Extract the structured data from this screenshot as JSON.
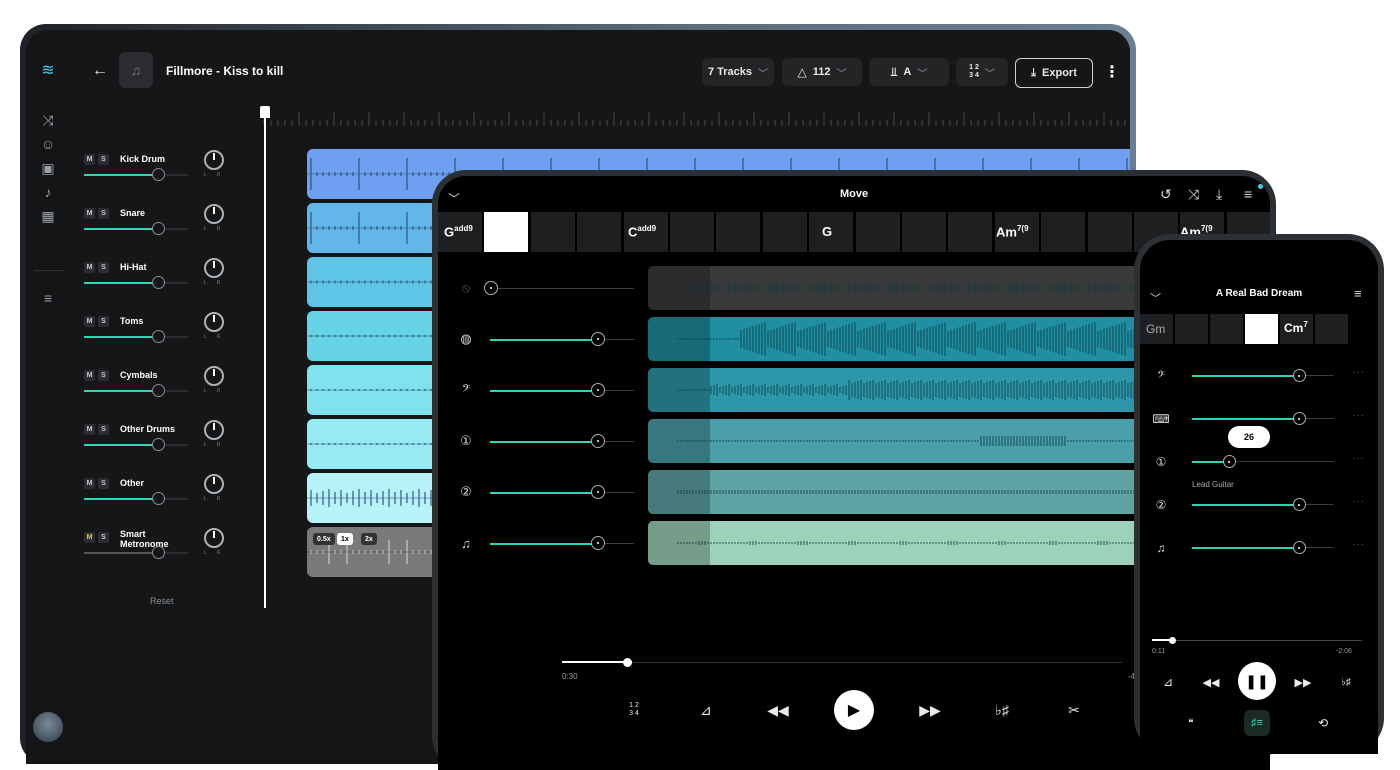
{
  "desktop": {
    "song_title": "Fillmore - Kiss to kill",
    "tracks_btn": "7 Tracks",
    "tempo": "112",
    "key": "A",
    "time_sig_top": "1 2",
    "time_sig_bottom": "3 4",
    "export_label": "Export",
    "mute_label": "M",
    "solo_label": "S",
    "tracks": [
      {
        "name": "Kick Drum",
        "volume": 0.7,
        "lane_color": "#6f9ff0"
      },
      {
        "name": "Snare",
        "volume": 0.7,
        "lane_color": "#63b6ea"
      },
      {
        "name": "Hi-Hat",
        "volume": 0.7,
        "lane_color": "#5fc5e6"
      },
      {
        "name": "Toms",
        "volume": 0.7,
        "lane_color": "#66d3e6"
      },
      {
        "name": "Cymbals",
        "volume": 0.7,
        "lane_color": "#7fe2ee"
      },
      {
        "name": "Other Drums",
        "volume": 0.7,
        "lane_color": "#96ebf3"
      },
      {
        "name": "Other",
        "volume": 0.7,
        "lane_color": "#b6f2f7"
      },
      {
        "name": "Smart Metronome",
        "volume": 0.7,
        "lane_color": "#7a7a7a"
      }
    ],
    "speed_options": [
      "0.5x",
      "1x",
      "2x"
    ],
    "reset_label": "Reset",
    "pan_left": "L",
    "pan_right": "R"
  },
  "tablet": {
    "title": "Move",
    "chords": [
      "G",
      "add9",
      "C",
      "add9",
      "G",
      "Am",
      "7(9",
      "Am",
      "7(9"
    ],
    "time_elapsed": "0:30",
    "time_remaining": "-4",
    "time_sig_top": "1 2",
    "time_sig_bottom": "3 4",
    "tracks": [
      {
        "icon": "mic-off-icon",
        "volume": 0.0,
        "color": "#3a3a3a"
      },
      {
        "icon": "drum-icon",
        "volume": 0.75,
        "color": "#1f8fa1"
      },
      {
        "icon": "bass-icon",
        "volume": 0.75,
        "color": "#2c97a9"
      },
      {
        "icon": "guitar-1-icon",
        "volume": 0.75,
        "color": "#4a9fab"
      },
      {
        "icon": "guitar-2-icon",
        "volume": 0.75,
        "color": "#5fa4a4"
      },
      {
        "icon": "music-note-icon",
        "volume": 0.75,
        "color": "#9ed1b9"
      }
    ]
  },
  "phone": {
    "title": "A Real Bad Dream",
    "chords": [
      "Gm",
      "Cm",
      "7"
    ],
    "lead_tooltip": "26",
    "lead_label": "Lead Guitar",
    "time_elapsed": "0:11",
    "time_remaining": "-2:06",
    "more_dots": "···",
    "tracks": [
      {
        "icon": "bass-icon",
        "volume": 0.75
      },
      {
        "icon": "piano-icon",
        "volume": 0.75
      },
      {
        "icon": "guitar-1-icon",
        "volume": 0.26
      },
      {
        "icon": "guitar-2-icon",
        "volume": 0.75
      },
      {
        "icon": "music-note-icon",
        "volume": 0.75
      }
    ]
  },
  "colors": {
    "accent": "#2fd3b6",
    "bg": "#000000",
    "panel": "#151617"
  }
}
